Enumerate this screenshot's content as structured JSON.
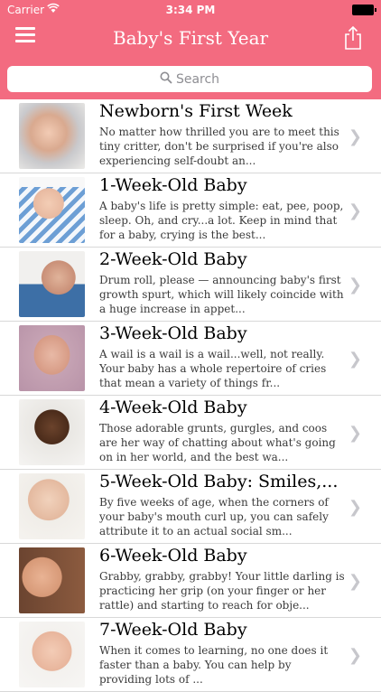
{
  "status": {
    "carrier": "Carrier",
    "time": "3:34 PM"
  },
  "nav": {
    "title": "Baby's First Year"
  },
  "search": {
    "placeholder": "Search"
  },
  "colors": {
    "brand": "#f36b80"
  },
  "items": [
    {
      "title": "Newborn's First Week",
      "desc": "No matter how thrilled you are to meet this tiny critter, don't be surprised if you're also experiencing self-doubt an..."
    },
    {
      "title": "1-Week-Old Baby",
      "desc": "A baby's life is pretty simple: eat, pee, poop, sleep. Oh, and cry...a lot. Keep in mind that for a baby, crying is the best..."
    },
    {
      "title": "2-Week-Old Baby",
      "desc": "Drum roll, please — announcing baby's first growth spurt, which will likely coincide with a huge increase in appet..."
    },
    {
      "title": "3-Week-Old Baby",
      "desc": "A wail is a wail is a wail...well, not really. Your baby has a whole repertoire of cries that mean a variety of things fr..."
    },
    {
      "title": "4-Week-Old Baby",
      "desc": "Those adorable grunts, gurgles, and coos are her way of chatting about what's going on in her world, and the best wa..."
    },
    {
      "title": "5-Week-Old Baby: Smiles,...",
      "desc": "By five weeks of age, when the corners of your baby's mouth curl up, you can safely attribute it to an actual social sm..."
    },
    {
      "title": "6-Week-Old Baby",
      "desc": "Grabby, grabby, grabby! Your little darling is practicing her grip (on your finger or her rattle) and starting to reach for obje..."
    },
    {
      "title": "7-Week-Old Baby",
      "desc": "When it comes to learning, no one does it faster than a baby. You can help by providing lots of ..."
    }
  ]
}
